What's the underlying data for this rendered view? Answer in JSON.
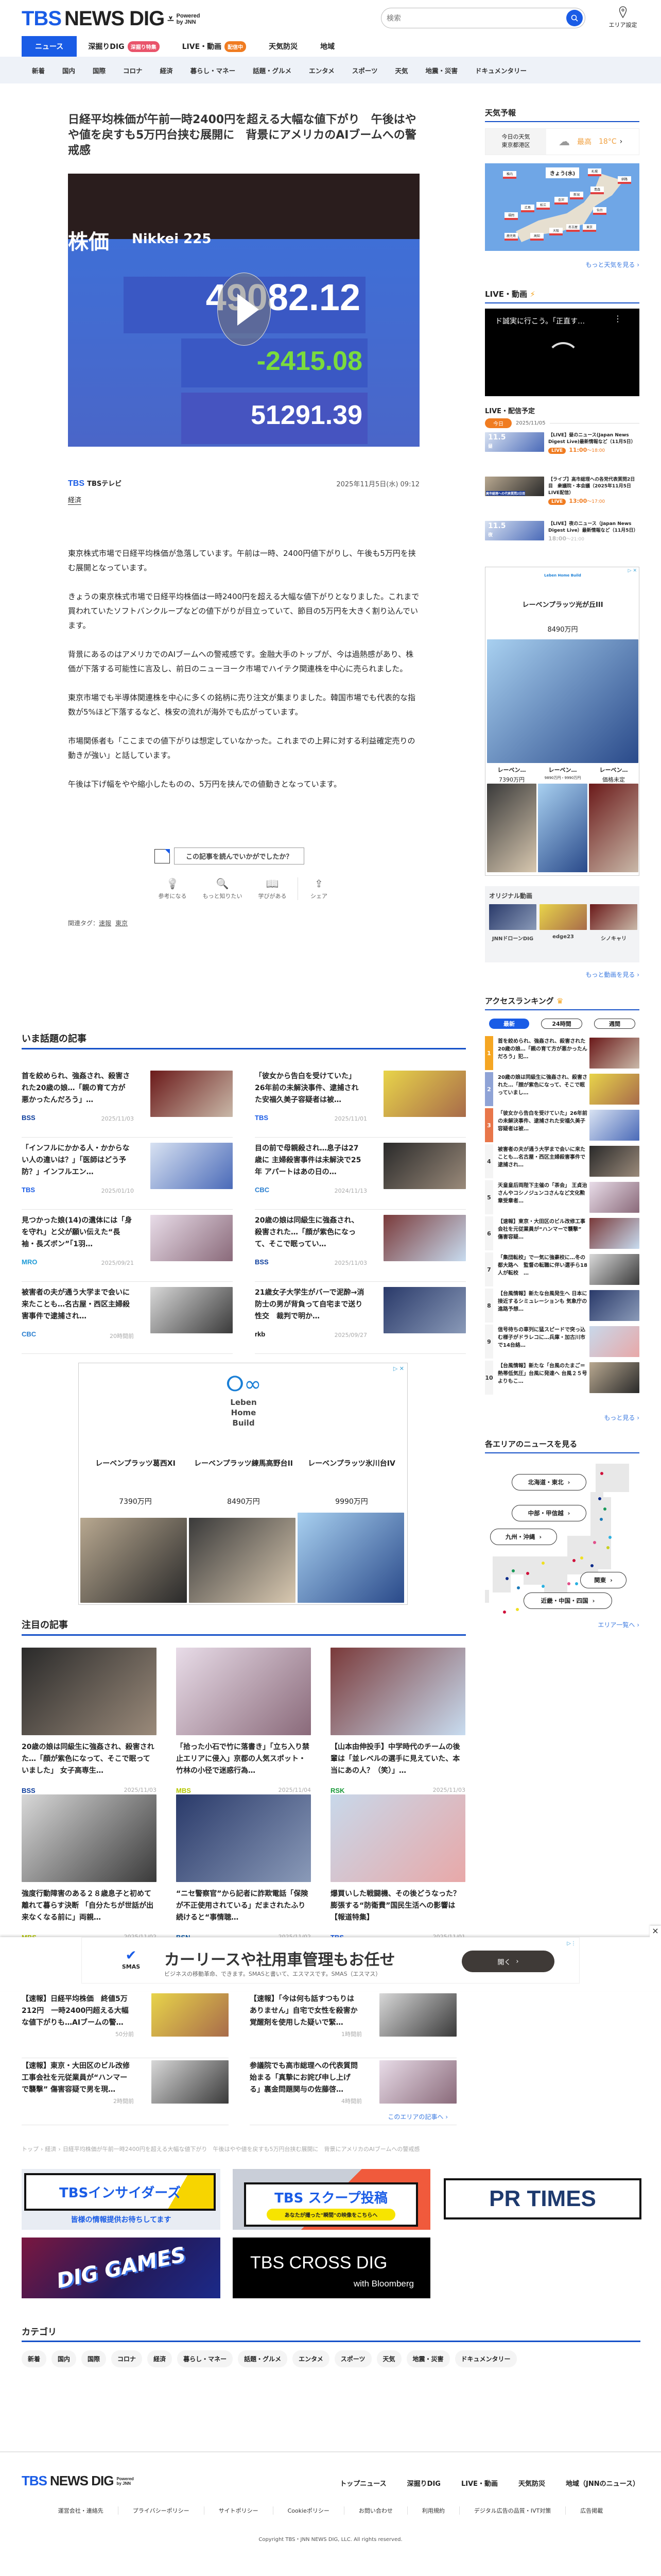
{
  "header": {
    "logo_tbs": "TBS",
    "logo_rest": "NEWS DIG",
    "powered": "Powered",
    "by": "by JNN",
    "search_placeholder": "検索",
    "area_label": "エリア設定"
  },
  "nav": {
    "tabs": [
      {
        "label": "ニュース",
        "active": true
      },
      {
        "label": "深掘りDIG",
        "badge": "深掘り特集",
        "badge_color": "#e9546b"
      },
      {
        "label": "LIVE・動画",
        "badge": "配信中",
        "badge_color": "#f07c21"
      },
      {
        "label": "天気防災"
      },
      {
        "label": "地域"
      }
    ],
    "sub": [
      "新着",
      "国内",
      "国際",
      "コロナ",
      "経済",
      "暮らし・マネー",
      "話題・グルメ",
      "エンタメ",
      "スポーツ",
      "天気",
      "地震・災害",
      "ドキュメンタリー"
    ]
  },
  "article": {
    "title": "日経平均株価が午前一時2400円を超える大幅な値下がり　午後はやや値を戻すも5万円台挟む展開に　背景にアメリカのAIブームへの警戒感",
    "image": {
      "label_jp": "株価",
      "label_en": "Nikkei 225",
      "price": "49082.12",
      "change": "-2415.08",
      "prev": "51291.39"
    },
    "source_logo": "TBS",
    "source": "TBSテレビ",
    "date": "2025年11月5日(水) 09:12",
    "category": "経済",
    "paragraphs": [
      "東京株式市場で日経平均株価が急落しています。午前は一時、2400円値下がりし、午後も5万円を挟む展開となっています。",
      "きょうの東京株式市場で日経平均株価は一時2400円を超える大幅な値下がりとなりました。これまで買われていたソフトバンクループなどの値下がりが目立っていて、節目の5万円を大きく割り込んでいます。",
      "背景にあるのはアメリカでのAIブームへの警戒感です。金融大手のトップが、今は過熱感があり、株価が下落する可能性に言及し、前日のニューヨーク市場でハイテク関連株を中心に売られました。",
      "東京市場でも半導体関連株を中心に多くの銘柄に売り注文が集まりました。韓国市場でも代表的な指数が5%ほど下落するなど、株安の流れが海外でも広がっています。",
      "市場関係者も「ここまでの値下がりは想定していなかった。これまでの上昇に対する利益確定売りの動きが強い」と話しています。",
      "午後は下げ幅をやや縮小したものの、5万円を挟んでの値動きとなっています。"
    ],
    "feedback": "この記事を読んでいかがでしたか？",
    "reactions": [
      {
        "label": "参考になる",
        "icon": "lightbulb-icon"
      },
      {
        "label": "もっと知りたい",
        "icon": "search-icon"
      },
      {
        "label": "学びがある",
        "icon": "book-icon"
      },
      {
        "label": "シェア",
        "icon": "share-icon"
      }
    ],
    "tags_label": "関連タグ：",
    "tags": [
      "速報",
      "東京"
    ]
  },
  "trending": {
    "title": "いま話題の記事",
    "items": [
      {
        "text": "首を絞められ、強姦され、殺害された20歳の娘…「親の育て方が悪かったんだろう」…",
        "source": "BSS",
        "date": "2025/11/03",
        "color": "#0b3c9c"
      },
      {
        "text": "「彼女から告白を受けていた」26年前の未解決事件、逮捕された安福久美子容疑者は被…",
        "source": "TBS",
        "date": "2025/11/01",
        "color": "#1a5ce6"
      },
      {
        "text": "「インフルにかかる人・かからない人の違いは？」「医師はどう予防？」インフルエン…",
        "source": "TBS",
        "date": "2025/01/10",
        "color": "#1a5ce6"
      },
      {
        "text": "目の前で母親殺され…息子は27歳に 主婦殺害事件は未解決で25年 アパートはあの日の…",
        "source": "CBC",
        "date": "2024/11/13",
        "color": "#2a7fd0"
      },
      {
        "text": "見つかった娘(14)の遺体には「身を守れ」と父が願い伝えた“長袖・長ズボン”「1羽…",
        "source": "MRO",
        "date": "2025/09/21",
        "color": "#1d9ad6"
      },
      {
        "text": "20歳の娘は同級生に強姦され、殺害された…「顔が紫色になって、そこで眠ってい…",
        "source": "BSS",
        "date": "2025/11/03",
        "color": "#0b3c9c"
      },
      {
        "text": "被害者の夫が通う大学まで会いに来たことも…名古屋・西区主婦殺害事件で逮捕され…",
        "source": "CBC",
        "date": "20時間前",
        "color": "#2a7fd0"
      },
      {
        "text": "21歳女子大学生がバーで泥酔→消防士の男が背負って自宅まで送り性交　裁判で明か…",
        "source": "rkb",
        "date": "2025/09/27",
        "color": "#111"
      }
    ]
  },
  "main_ad": {
    "brand": [
      "Leben",
      "Home",
      "Build"
    ],
    "items": [
      {
        "name": "レーベンプラッツ葛西XI",
        "price": "7390万円"
      },
      {
        "name": "レーベンプラッツ練馬高野台II",
        "price": "8490万円"
      },
      {
        "name": "レーベンプラッツ氷川台IV",
        "price": "9990万円"
      }
    ]
  },
  "featured": {
    "title": "注目の記事",
    "items": [
      {
        "text": "20歳の娘は同級生に強姦され、殺害された…「顔が紫色になって、そこで眠っていました」 女子高専生…",
        "source": "BSS",
        "date": "2025/11/03",
        "color": "#0b3c9c"
      },
      {
        "text": "「拾った小石で竹に落書き」「立ち入り禁止エリアに侵入」京都の人気スポット・竹林の小径で迷惑行為…",
        "source": "MBS",
        "date": "2025/11/04",
        "color": "#b5c800"
      },
      {
        "text": "【山本由伸投手】中学時代のチームの後輩は「並レベルの選手に見えていた、本当にあの人？（笑）」…",
        "source": "RSK",
        "date": "2025/11/03",
        "color": "#1a9a3a"
      },
      {
        "text": "強度行動障害のある２８歳息子と初めて離れて暮らす決断 「自分たちが世話が出来なくなる前に」両親…",
        "source": "MBS",
        "date": "2025/11/02",
        "color": "#b5c800"
      },
      {
        "text": "“ニセ警察官”から記者に詐欺電話「保険が不正使用されている」だまされたふり続けると“事情聴…",
        "source": "BSN",
        "date": "2025/11/02",
        "color": "#0b5aa8"
      },
      {
        "text": "爆買いした戦闘機、その後どうなった？膨張する“防衛費”国民生活への影響は【報道特集】",
        "source": "TBS",
        "date": "2025/11/01",
        "color": "#1a5ce6"
      }
    ]
  },
  "sticky_ad": {
    "logo": "SMAS",
    "headline": "カーリースや社用車管理もお任せ",
    "sub": "ビジネスの移動革命、できます。SMASと書いて、エスマスです。SMAS（エスマス）",
    "button": "開く"
  },
  "area_news": {
    "items": [
      {
        "text": "【速報】日経平均株価　終値5万212円　一時2400円超える大幅な値下がりも…AIブームの警…",
        "time": "50分前"
      },
      {
        "text": "【速報】「今は何も話すつもりはありません」自宅で女性を殺害か 覚醒剤を使用した疑いで緊…",
        "time": "1時間前"
      },
      {
        "text": "【速報】東京・大田区のビル改修工事会社を元従業員が“ハンマーで襲撃” 傷害容疑で男を現…",
        "time": "2時間前"
      },
      {
        "text": "参議院でも高市総理への代表質問始まる「真摯にお詫び申し上げる」裏金問題関与の佐藤啓…",
        "time": "4時間前"
      }
    ],
    "more": "このエリアの記事へ"
  },
  "breadcrumb": [
    "トップ",
    "経済",
    "日経平均株価が午前一時2400円を超える大幅な値下がり　午後はやや値を戻すも5万円台挟む展開に　背景にアメリカのAIブームへの警戒感"
  ],
  "banners": {
    "insiders": {
      "title": "TBSインサイダーズ",
      "sub": "皆様の情報提供お待ちしてます"
    },
    "scoop": {
      "title": "TBS スクープ投稿",
      "sub": "あなたが撮った\"瞬間\"の映像をこちらへ"
    },
    "prtimes": "PR TIMES",
    "diggames": "DIG GAMES",
    "crossdig": {
      "title": "TBS CROSS DIG",
      "sub": "with Bloomberg"
    }
  },
  "categories": {
    "title": "カテゴリ",
    "items": [
      "新着",
      "国内",
      "国際",
      "コロナ",
      "経済",
      "暮らし・マネー",
      "話題・グルメ",
      "エンタメ",
      "スポーツ",
      "天気",
      "地震・災害",
      "ドキュメンタリー"
    ]
  },
  "footer": {
    "nav": [
      "トップニュース",
      "深掘りDIG",
      "LIVE・動画",
      "天気防災",
      "地域（JNNのニュース）"
    ],
    "links": [
      "運営会社・連絡先",
      "プライバシーポリシー",
      "サイトポリシー",
      "Cookieポリシー",
      "お問い合わせ",
      "利用規約",
      "デジタル広告の品質・IVT対策",
      "広告掲載"
    ],
    "copyright": "Copyright TBS・JNN NEWS DIG, LLC. All rights reserved."
  },
  "sidebar": {
    "weather": {
      "title": "天気予報",
      "today": "今日の天気",
      "place": "東京都港区",
      "high_label": "最高",
      "high": "18°C",
      "map_title": "きょう(水)",
      "cities": [
        "稚内",
        "札幌",
        "釧路",
        "青森",
        "仙台",
        "新潟",
        "金沢",
        "松江",
        "広島",
        "福岡",
        "鹿児島",
        "高知",
        "大阪",
        "名古屋",
        "東京"
      ],
      "more": "もっと天気を見る"
    },
    "live": {
      "title": "LIVE・動画",
      "video_title": "ド誠実に行こう。「正直す…",
      "schedule_title": "LIVE・配信予定",
      "today": "今日",
      "date": "2025/11/05",
      "items": [
        {
          "text": "【LIVE】昼のニュース(Japan News Digest Live)最新情報など（11月5日）",
          "live": "LIVE",
          "start": "11:00",
          "end": "～18:00",
          "thumb_date": "11.5",
          "thumb_label": "昼"
        },
        {
          "text": "【ライブ】高市総理への各党代表質問2日目　衆議院・本会議（2025年11月5日LIVE配信）",
          "live": "LIVE",
          "start": "13:00",
          "end": "～17:00",
          "thumb_caption": "高市総理への代表質問2日目"
        },
        {
          "text": "【LIVE】夜のニュース（Japan News Digest Live）最新情報など（11月5日）",
          "start": "18:00",
          "end": "～21:00",
          "thumb_date": "11.5",
          "thumb_label": "夜"
        }
      ]
    },
    "ad": {
      "brand": "Leben Home Build",
      "title": "レーベンプラッツ光が丘III",
      "price": "8490万円",
      "items": [
        {
          "name": "レーベン…",
          "price": "7390万円"
        },
        {
          "name": "レーベン…",
          "price": "9890万円・9990万円"
        },
        {
          "name": "レーベン…",
          "price": "価格未定"
        }
      ]
    },
    "original": {
      "title": "オリジナル動画",
      "items": [
        "JNNドローンDIG",
        "edge23",
        "シノキャリ"
      ],
      "more": "もっと動画を見る"
    },
    "ranking": {
      "title": "アクセスランキング",
      "tabs": [
        "最新",
        "24時間",
        "週間"
      ],
      "items": [
        "首を絞められ、強姦され、殺害された20歳の娘…「親の育て方が悪かったんだろう」犯…",
        "20歳の娘は同級生に強姦され、殺害された…「顔が紫色になって、そこで眠っていまし…",
        "「彼女から告白を受けていた」26年前の未解決事件、逮捕された安福久美子容疑者は被…",
        "被害者の夫が通う大学まで会いに来たことも…名古屋・西区主婦殺害事件で逮捕され…",
        "天皇皇后両陛下主催の「茶会」 王貞治さんやコシノジュンコさんなど文化勲章受章者…",
        "【速報】東京・大田区のビル改修工事会社を元従業員が“ハンマーで襲撃” 傷害容疑…",
        "「集団転校」で一気に強豪校に…冬の都大路へ　監督の転職に伴い選手ら18人が転校　…",
        "【台風情報】新たな台風発生へ 日本に接近するシミュレーションも 気象庁の進路予想…",
        "信号待ちの車列に猛スピードで突っ込む様子がドラレコに…兵庫・加古川市で14台絡…",
        "【台風情報】新たな「台風のたまご＝熱帯低気圧」台風に発達へ 台風２５号よりもこ…"
      ],
      "more": "もっと見る"
    },
    "area": {
      "title": "各エリアのニュースを見る",
      "buttons": [
        "北海道・東北",
        "中部・甲信越",
        "九州・沖縄",
        "関東",
        "近畿・中国・四国"
      ],
      "more": "エリア一覧へ"
    }
  },
  "colors": {
    "accent": "#1a5ce6",
    "underline": "#1550c8",
    "rank1": "#f5a623",
    "rank2": "#8fa3d6",
    "rank3": "#e8764a",
    "live": "#f07c21"
  }
}
